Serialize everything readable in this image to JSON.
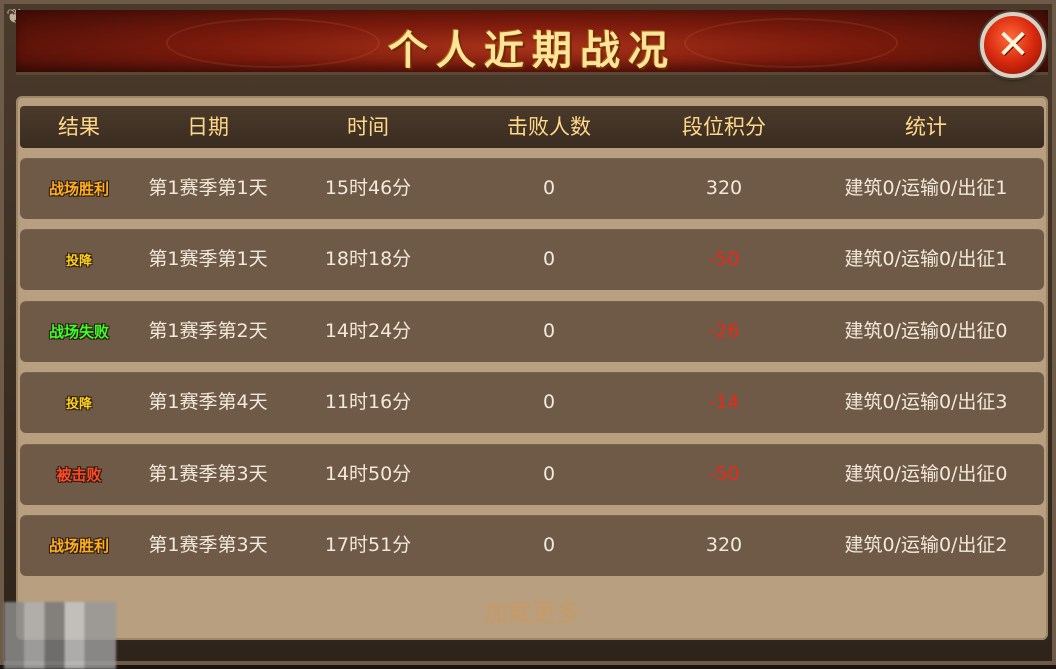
{
  "dialog": {
    "title": "个人近期战况",
    "close_label": "✕"
  },
  "table": {
    "headers": [
      "结果",
      "日期",
      "时间",
      "击败人数",
      "段位积分",
      "统计"
    ],
    "rows": [
      {
        "result": "战场胜利",
        "result_color": "#ffb020",
        "date": "第1赛季第1天",
        "time": "15时46分",
        "defeats": "0",
        "score": "320",
        "score_color": "#f3e9da",
        "stats": "建筑0/运输0/出征1"
      },
      {
        "result": "投降",
        "result_color": "#ffd21a",
        "date": "第1赛季第1天",
        "time": "18时18分",
        "defeats": "0",
        "score": "-50",
        "score_color": "#e8281a",
        "stats": "建筑0/运输0/出征1"
      },
      {
        "result": "战场失败",
        "result_color": "#3cff2a",
        "date": "第1赛季第2天",
        "time": "14时24分",
        "defeats": "0",
        "score": "-26",
        "score_color": "#e8281a",
        "stats": "建筑0/运输0/出征0"
      },
      {
        "result": "投降",
        "result_color": "#ffd21a",
        "date": "第1赛季第4天",
        "time": "11时16分",
        "defeats": "0",
        "score": "-14",
        "score_color": "#e8281a",
        "stats": "建筑0/运输0/出征3"
      },
      {
        "result": "被击败",
        "result_color": "#ff4a2a",
        "date": "第1赛季第3天",
        "time": "14时50分",
        "defeats": "0",
        "score": "-50",
        "score_color": "#e8281a",
        "stats": "建筑0/运输0/出征0"
      },
      {
        "result": "战场胜利",
        "result_color": "#ffb020",
        "date": "第1赛季第3天",
        "time": "17时51分",
        "defeats": "0",
        "score": "320",
        "score_color": "#f3e9da",
        "stats": "建筑0/运输0/出征2"
      }
    ],
    "load_more_label": "加载更多"
  },
  "colors": {
    "header_text": "#ffd88a",
    "panel_bg": "#b79f7f",
    "row_bg": "#6e5a47",
    "negative_score": "#e8281a",
    "load_more": "#c99a63"
  }
}
